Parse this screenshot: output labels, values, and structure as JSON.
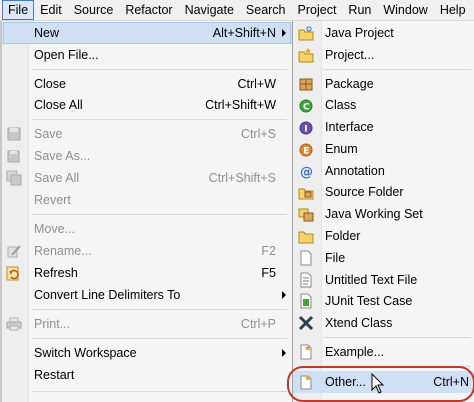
{
  "menubar": [
    "File",
    "Edit",
    "Source",
    "Refactor",
    "Navigate",
    "Search",
    "Project",
    "Run",
    "Window",
    "Help"
  ],
  "file_menu": {
    "new": {
      "label": "New",
      "accel": "Alt+Shift+N"
    },
    "open_file": {
      "label": "Open File..."
    },
    "close": {
      "label": "Close",
      "accel": "Ctrl+W"
    },
    "close_all": {
      "label": "Close All",
      "accel": "Ctrl+Shift+W"
    },
    "save": {
      "label": "Save",
      "accel": "Ctrl+S"
    },
    "save_as": {
      "label": "Save As..."
    },
    "save_all": {
      "label": "Save All",
      "accel": "Ctrl+Shift+S"
    },
    "revert": {
      "label": "Revert"
    },
    "move": {
      "label": "Move..."
    },
    "rename": {
      "label": "Rename...",
      "accel": "F2"
    },
    "refresh": {
      "label": "Refresh",
      "accel": "F5"
    },
    "convert": {
      "label": "Convert Line Delimiters To"
    },
    "print": {
      "label": "Print...",
      "accel": "Ctrl+P"
    },
    "switch_workspace": {
      "label": "Switch Workspace"
    },
    "restart": {
      "label": "Restart"
    }
  },
  "new_submenu": {
    "java_project": "Java Project",
    "project": "Project...",
    "package": "Package",
    "class": "Class",
    "interface": "Interface",
    "enum": "Enum",
    "annotation": "Annotation",
    "source_folder": "Source Folder",
    "java_working_set": "Java Working Set",
    "folder": "Folder",
    "file": "File",
    "untitled_text_file": "Untitled Text File",
    "junit_test_case": "JUnit Test Case",
    "xtend_class": "Xtend Class",
    "example": "Example...",
    "other": {
      "label": "Other...",
      "accel": "Ctrl+N"
    }
  },
  "colors": {
    "highlight": "#cfe0f5",
    "annotation_oval": "#c0392b"
  }
}
